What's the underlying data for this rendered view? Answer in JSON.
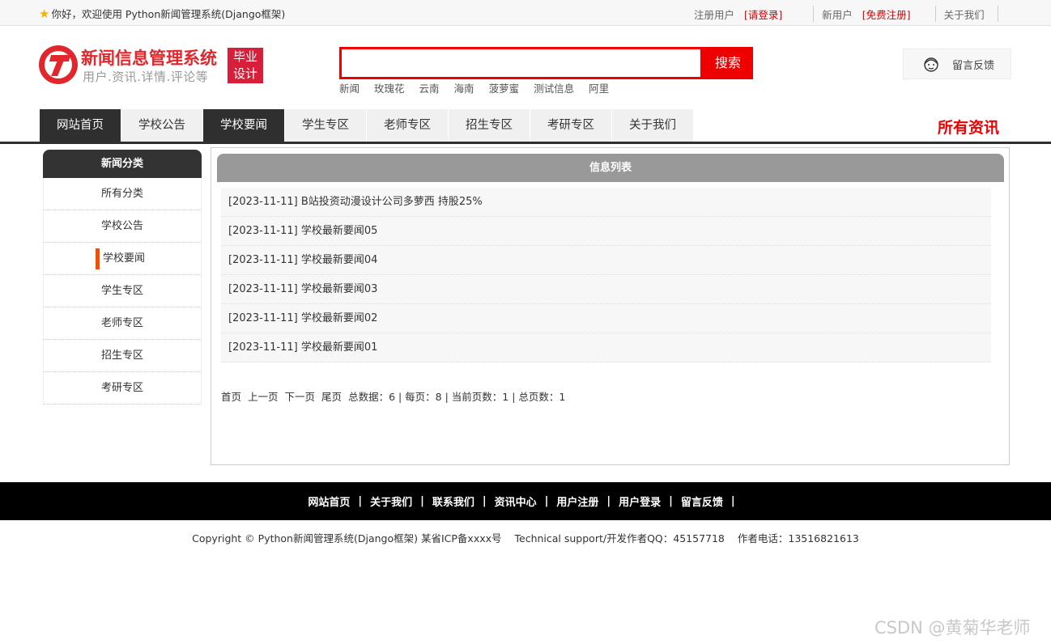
{
  "topbar": {
    "welcome": "你好，欢迎使用 Python新闻管理系统(Django框架)",
    "register_user": "注册用户",
    "login_link": "[请登录]",
    "new_user": "新用户",
    "free_register": "[免费注册]",
    "about": "关于我们"
  },
  "logo": {
    "name": "新闻信息管理系统",
    "slogan": "用户.资讯.详情.评论等",
    "badge_line1": "毕业",
    "badge_line2": "设计"
  },
  "search": {
    "value": "",
    "button": "搜索",
    "hotwords": [
      "新闻",
      "玫瑰花",
      "云南",
      "海南",
      "菠萝蜜",
      "测试信息",
      "阿里"
    ]
  },
  "feedback": {
    "label": "留言反馈"
  },
  "nav": {
    "items": [
      "网站首页",
      "学校公告",
      "学校要闻",
      "学生专区",
      "老师专区",
      "招生专区",
      "考研专区",
      "关于我们"
    ],
    "all_news": "所有资讯"
  },
  "sidebar": {
    "title": "新闻分类",
    "items": [
      "所有分类",
      "学校公告",
      "学校要闻",
      "学生专区",
      "老师专区",
      "招生专区",
      "考研专区"
    ],
    "active_index": 2
  },
  "main": {
    "title": "信息列表",
    "rows": [
      "[2023-11-11] B站投资动漫设计公司多萝西 持股25%",
      "[2023-11-11] 学校最新要闻05",
      "[2023-11-11] 学校最新要闻04",
      "[2023-11-11] 学校最新要闻03",
      "[2023-11-11] 学校最新要闻02",
      "[2023-11-11] 学校最新要闻01"
    ],
    "pager": {
      "first": "首页",
      "prev": "上一页",
      "next": "下一页",
      "last": "尾页",
      "summary": "总数据：6 | 每页：8 | 当前页数：1 | 总页数：1"
    }
  },
  "footer": {
    "links": [
      "网站首页",
      "关于我们",
      "联系我们",
      "资讯中心",
      "用户注册",
      "用户登录",
      "留言反馈"
    ],
    "copyright": "Copyright © Python新闻管理系统(Django框架) 某省ICP备xxxx号",
    "support": "Technical support/开发作者QQ：45157718",
    "phone": "作者电话：13516821613"
  },
  "watermark": "CSDN @黄菊华老师",
  "colors": {
    "brand_red": "#e3262b",
    "search_red": "#ee0000",
    "nav_dark": "#2f2f2f",
    "active_marker": "#f25000"
  }
}
